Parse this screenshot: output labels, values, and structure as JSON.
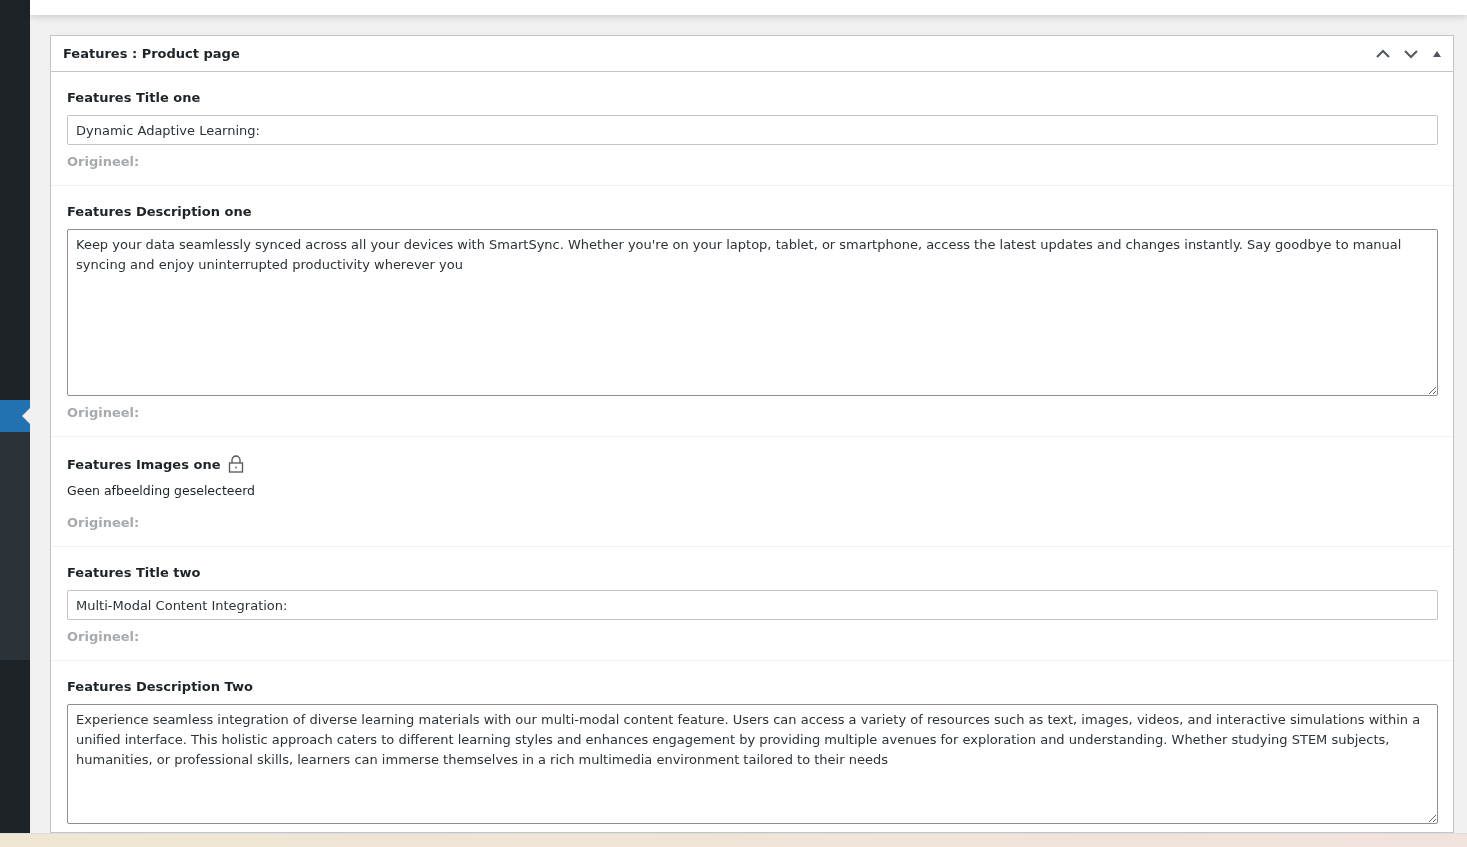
{
  "panel": {
    "title": "Features : Product page",
    "expanded": true,
    "fields": [
      {
        "kind": "text",
        "label": "Features Title one",
        "value": "Dynamic Adaptive Learning:",
        "original_label": "Origineel:"
      },
      {
        "kind": "textarea",
        "label": "Features Description one",
        "value": "Keep your data seamlessly synced across all your devices with SmartSync. Whether you're on your laptop, tablet, or smartphone, access the latest updates and changes instantly. Say goodbye to manual syncing and enjoy uninterrupted productivity wherever you",
        "original_label": "Origineel:"
      },
      {
        "kind": "image",
        "label": "Features Images one",
        "locked": true,
        "value": "Geen afbeelding geselecteerd",
        "original_label": "Origineel:"
      },
      {
        "kind": "text",
        "label": "Features Title two",
        "value": "Multi-Modal Content Integration:",
        "original_label": "Origineel:"
      },
      {
        "kind": "textarea",
        "label": "Features Description Two",
        "value": "Experience seamless integration of diverse learning materials with our multi-modal content feature. Users can access a variety of resources such as text, images, videos, and interactive simulations within a unified interface. This holistic approach caters to different learning styles and enhances engagement by providing multiple avenues for exploration and understanding. Whether studying STEM subjects, humanities, or professional skills, learners can immerse themselves in a rich multimedia environment tailored to their needs"
      }
    ]
  }
}
